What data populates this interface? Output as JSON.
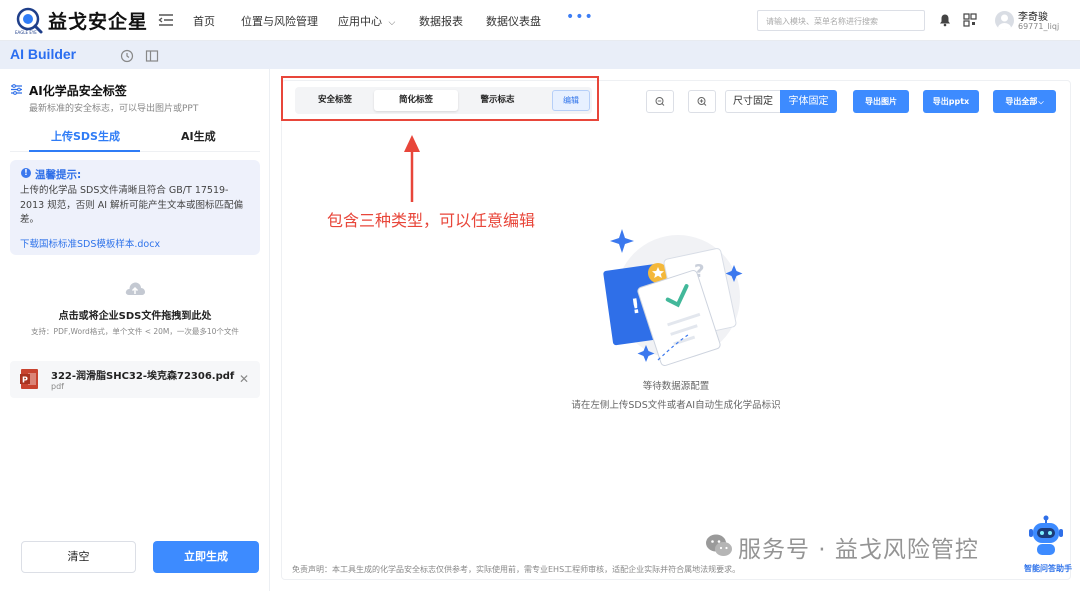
{
  "app": {
    "logo_text": "益戈安企星",
    "logo_sub": "EAGLE EYE"
  },
  "nav": {
    "items": [
      "首页",
      "位置与风险管理",
      "应用中心",
      "数据报表",
      "数据仪表盘"
    ],
    "more": "•••"
  },
  "search": {
    "placeholder": "请输入模块、菜单名称进行搜索"
  },
  "user": {
    "name": "李奇骏",
    "id": "69771_liqj"
  },
  "subbar": {
    "title": "AI Builder"
  },
  "left": {
    "title": "AI化学品安全标签",
    "subtitle": "最新标准的安全标志，可以导出图片或PPT",
    "tabs": [
      "上传SDS生成",
      "AI生成"
    ],
    "tip": {
      "title": "温馨提示:",
      "body": "上传的化学品 SDS文件清晰且符合 GB/T 17519-2013 规范，否则 AI 解析可能产生文本或图标匹配偏差。",
      "link": "下载国标标准SDS模板样本.docx"
    },
    "upload": {
      "title": "点击或将企业SDS文件拖拽到此处",
      "hint": "支持：PDF,Word格式，单个文件 < 20M，一次最多10个文件"
    },
    "file": {
      "name": "322-润滑脂SHC32-埃克森72306.pdf",
      "type": "pdf"
    },
    "buttons": {
      "clear": "清空",
      "generate": "立即生成"
    }
  },
  "toolbar": {
    "segments": [
      "安全标签",
      "简化标签",
      "警示标志"
    ],
    "active_segment": 1,
    "edit": "编辑",
    "size_fixed": "尺寸固定",
    "font_fixed": "字体固定",
    "export_image": "导出图片",
    "export_pptx": "导出pptx",
    "export_all": "导出全部"
  },
  "annotation": "包含三种类型，可以任意编辑",
  "empty": {
    "line1": "等待数据源配置",
    "line2": "请在左侧上传SDS文件或者AI自动生成化学品标识"
  },
  "disclaimer": "免责声明：本工具生成的化学品安全标志仅供参考，实际使用前，需专业EHS工程师审核，适配企业实际并符合属地法规要求。",
  "watermark": "服务号 · 益戈风险管控",
  "assistant": "智能问答助手",
  "colors": {
    "primary": "#3d8bff",
    "annotation_red": "#e8463a",
    "subbar": "#e9eef8"
  }
}
